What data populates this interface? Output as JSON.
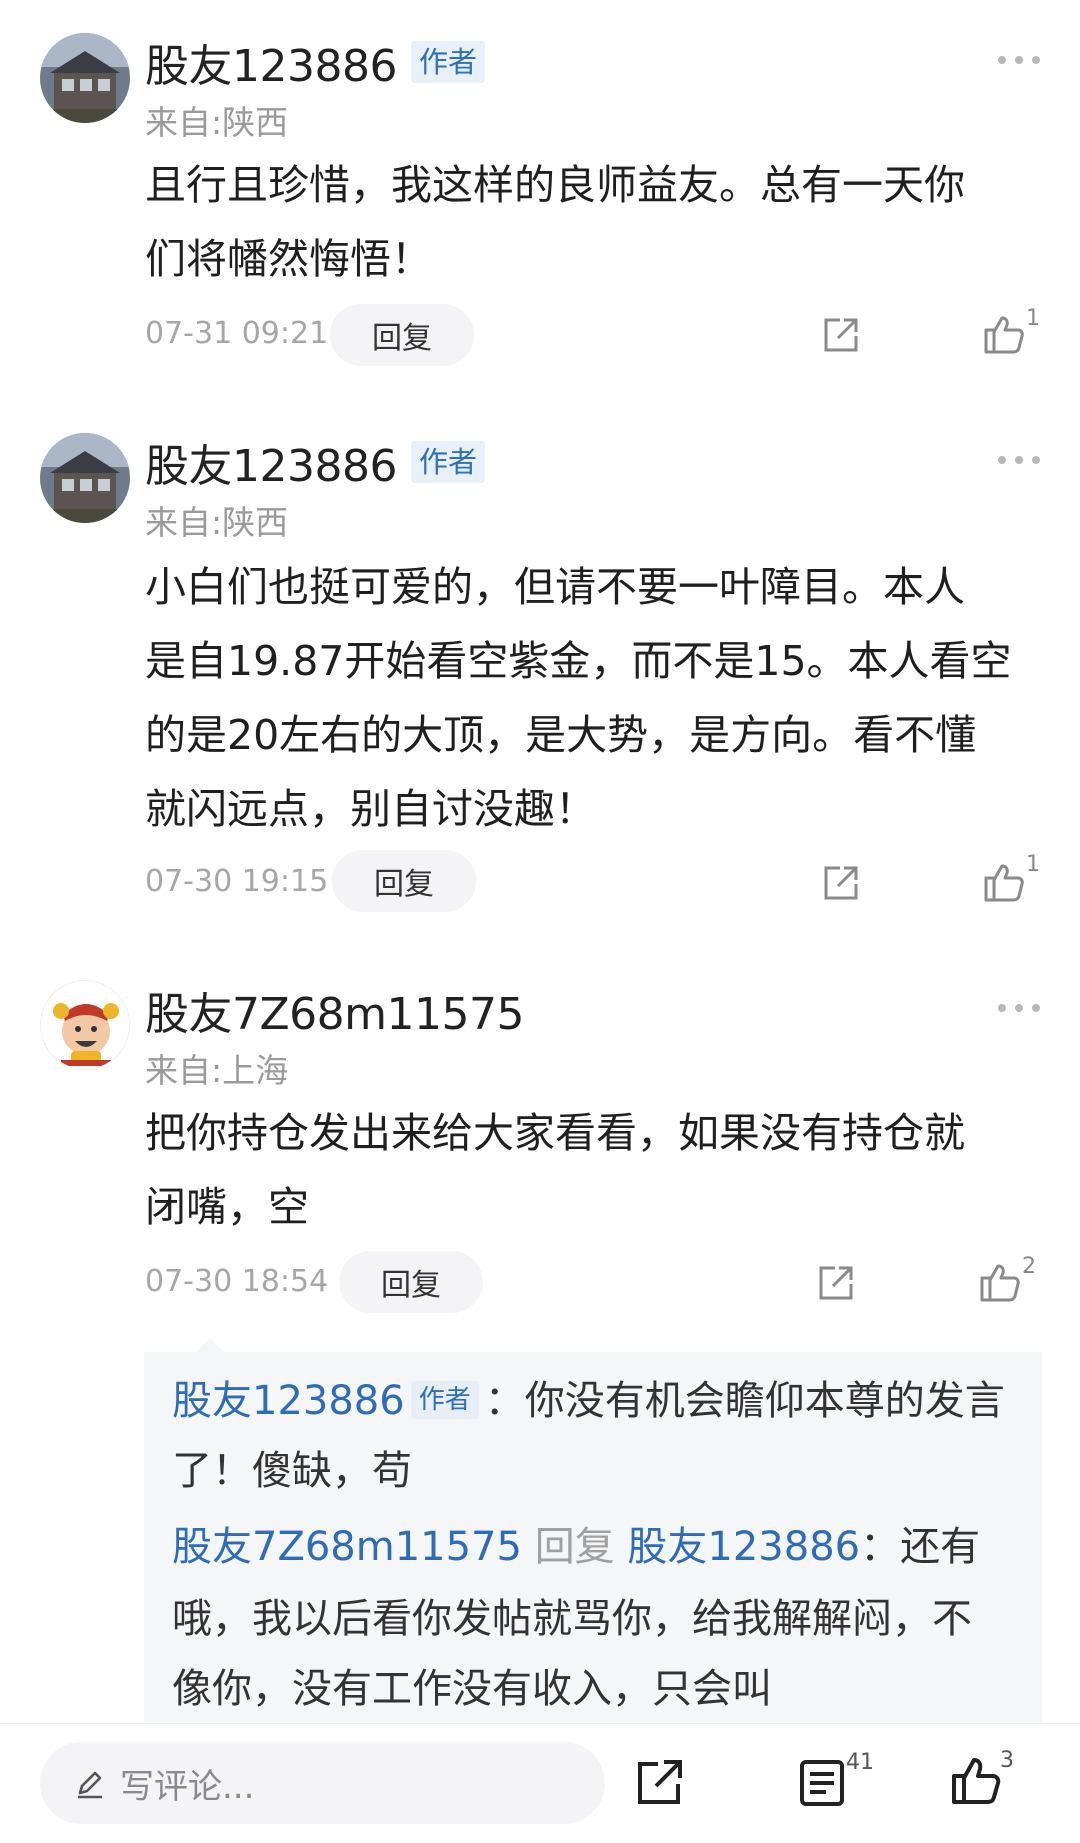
{
  "comments": [
    {
      "name": "股友123886",
      "author_tag": "作者",
      "location": "来自:陕西",
      "content_lines": [
        "且行且珍惜，我这样的良师益友。总有一天你",
        "们将幡然悔悟！"
      ],
      "time": "07-31 09:21",
      "reply_label": "回复",
      "likes": "1"
    },
    {
      "name": "股友123886",
      "author_tag": "作者",
      "location": "来自:陕西",
      "content_lines": [
        "小白们也挺可爱的，但请不要一叶障目。本人",
        "是自19.87开始看空紫金，而不是15。本人看空",
        "的是20左右的大顶，是大势，是方向。看不懂",
        "就闪远点，别自讨没趣！"
      ],
      "time": "07-30 19:15",
      "reply_label": "回复",
      "likes": "1"
    },
    {
      "name": "股友7Z68m11575",
      "location": "来自:上海",
      "content_lines": [
        "把你持仓发出来给大家看看，如果没有持仓就",
        "闭嘴，空"
      ],
      "time": "07-30 18:54",
      "reply_label": "回复",
      "likes": "2"
    }
  ],
  "replies": [
    {
      "name": "股友123886",
      "author_tag": "作者",
      "line1": "：你没有机会瞻仰本尊的发言",
      "line2": "了！傻缺，苟"
    },
    {
      "name": "股友7Z68m11575",
      "reply_word": "回复",
      "target": "股友123886",
      "line1": "：还有",
      "line2": "哦，我以后看你发帖就骂你，给我解解闷，不",
      "line3": "像你，没有工作没有收入，只会叫"
    }
  ],
  "bottom_bar": {
    "placeholder": "写评论...",
    "comment_count": "41",
    "like_count": "3"
  },
  "icons": [
    "pencil-icon",
    "share-icon",
    "thumbs-up-icon",
    "more-dots-icon",
    "comment-list-icon"
  ],
  "colors": {
    "author_tag_bg": "#e8f1fb",
    "link_blue": "#2e6bb8",
    "muted_gray": "#9a9a9a"
  }
}
